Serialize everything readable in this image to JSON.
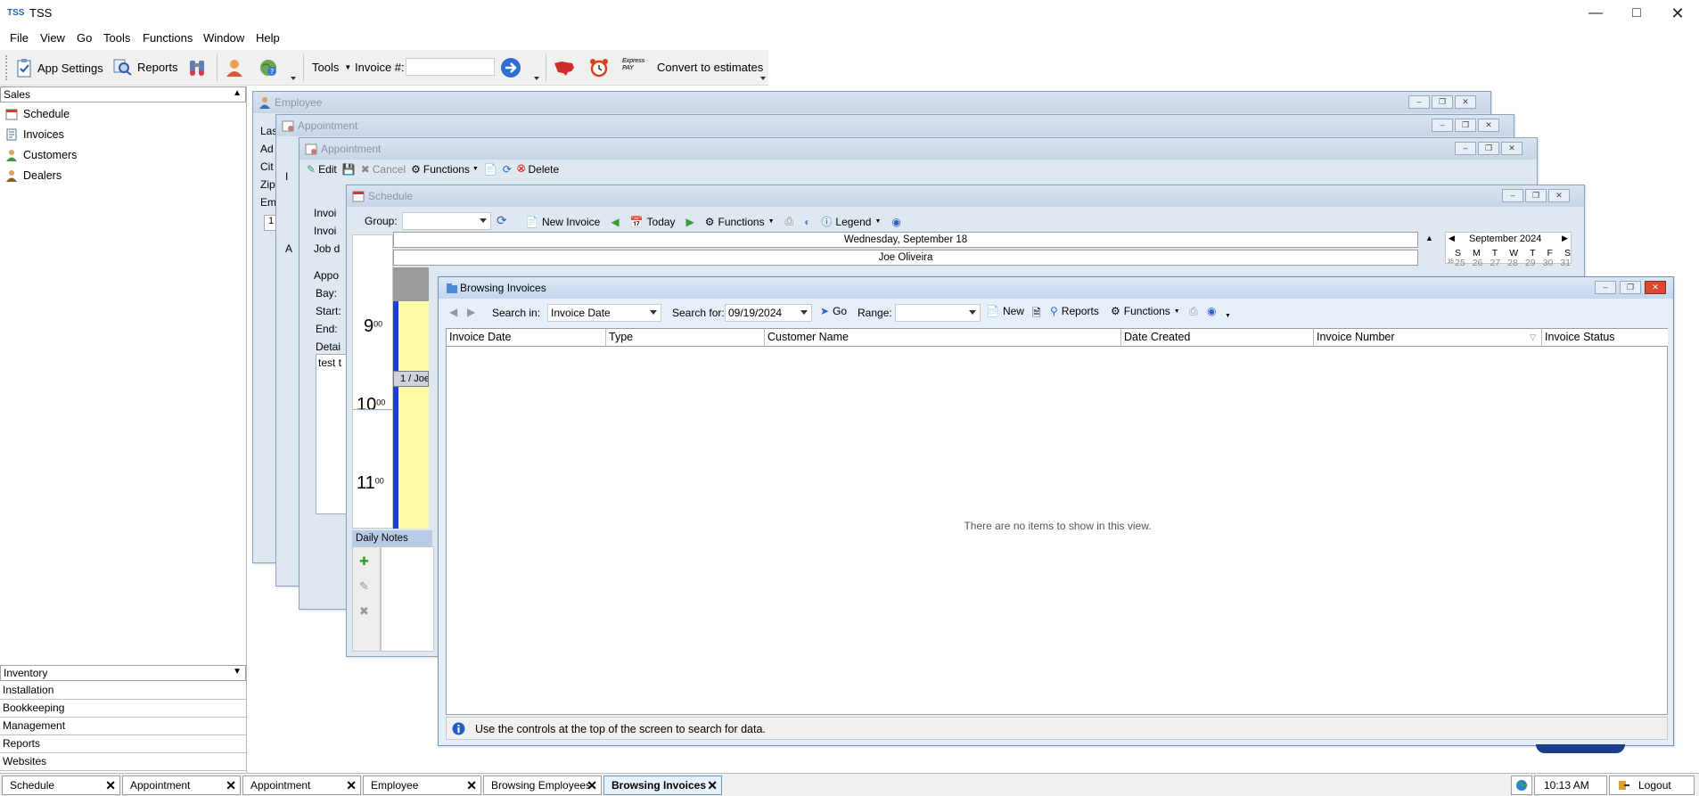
{
  "app": {
    "logo": "TSS",
    "title": "TSS"
  },
  "menu": [
    "File",
    "View",
    "Go",
    "Tools",
    "Functions",
    "Window",
    "Help"
  ],
  "toolbar": {
    "app_settings": "App Settings",
    "reports": "Reports",
    "tools": "Tools",
    "invoice_label": "Invoice #:",
    "invoice_value": "",
    "convert": "Convert to estimates",
    "express_pay": "Express PAY"
  },
  "sidebar": {
    "header": "Sales",
    "items": [
      "Schedule",
      "Invoices",
      "Customers",
      "Dealers"
    ],
    "categories": [
      "Inventory",
      "Installation",
      "Bookkeeping",
      "Management",
      "Reports",
      "Websites"
    ]
  },
  "windows": {
    "employee": {
      "title": "Employee",
      "frag": [
        "Las",
        "Ad",
        "Cit",
        "Zip",
        "Em",
        "1"
      ]
    },
    "appointment1": {
      "title": "Appointment",
      "frag": [
        "I",
        "A"
      ]
    },
    "appointment2": {
      "title": "Appointment",
      "toolbar": [
        "Edit",
        "Cancel",
        "Functions",
        "Delete"
      ],
      "frag": [
        "Invoi",
        "Invoi",
        "Job d",
        "Appo",
        "Bay:",
        "Start:",
        "End:",
        "Detai",
        "test t"
      ]
    },
    "schedule": {
      "title": "Schedule",
      "group_label": "Group:",
      "new_invoice": "New Invoice",
      "today": "Today",
      "functions": "Functions",
      "legend": "Legend",
      "date_header": "Wednesday, September 18",
      "person": "Joe Oliveira",
      "hours": [
        {
          "h": "9",
          "m": "00"
        },
        {
          "h": "10",
          "m": "00"
        },
        {
          "h": "11",
          "m": "00"
        }
      ],
      "appt_label": "1 / Joe",
      "daily_notes": "Daily Notes",
      "calendar": {
        "month": "September 2024",
        "days": [
          "S",
          "M",
          "T",
          "W",
          "T",
          "F",
          "S"
        ],
        "week_num": "35",
        "first_row": [
          "25",
          "26",
          "27",
          "28",
          "29",
          "30",
          "31"
        ]
      }
    },
    "browsing_invoices": {
      "title": "Browsing Invoices",
      "search_in_label": "Search in:",
      "search_in_value": "Invoice Date",
      "search_for_label": "Search for:",
      "search_for_value": "09/19/2024",
      "go": "Go",
      "range_label": "Range:",
      "range_value": "",
      "new": "New",
      "reports": "Reports",
      "functions": "Functions",
      "columns": [
        "Invoice Date",
        "Type",
        "Customer Name",
        "Date Created",
        "Invoice Number",
        "Invoice Status"
      ],
      "empty_message": "There are no items to show in this view.",
      "status_message": "Use the controls at the top of the screen to search for data."
    }
  },
  "taskbar": {
    "tasks": [
      "Schedule",
      "Appointment",
      "Appointment",
      "Employee",
      "Browsing Employees",
      "Browsing Invoices"
    ],
    "active_index": 5,
    "time": "10:13 AM",
    "logout": "Logout"
  }
}
